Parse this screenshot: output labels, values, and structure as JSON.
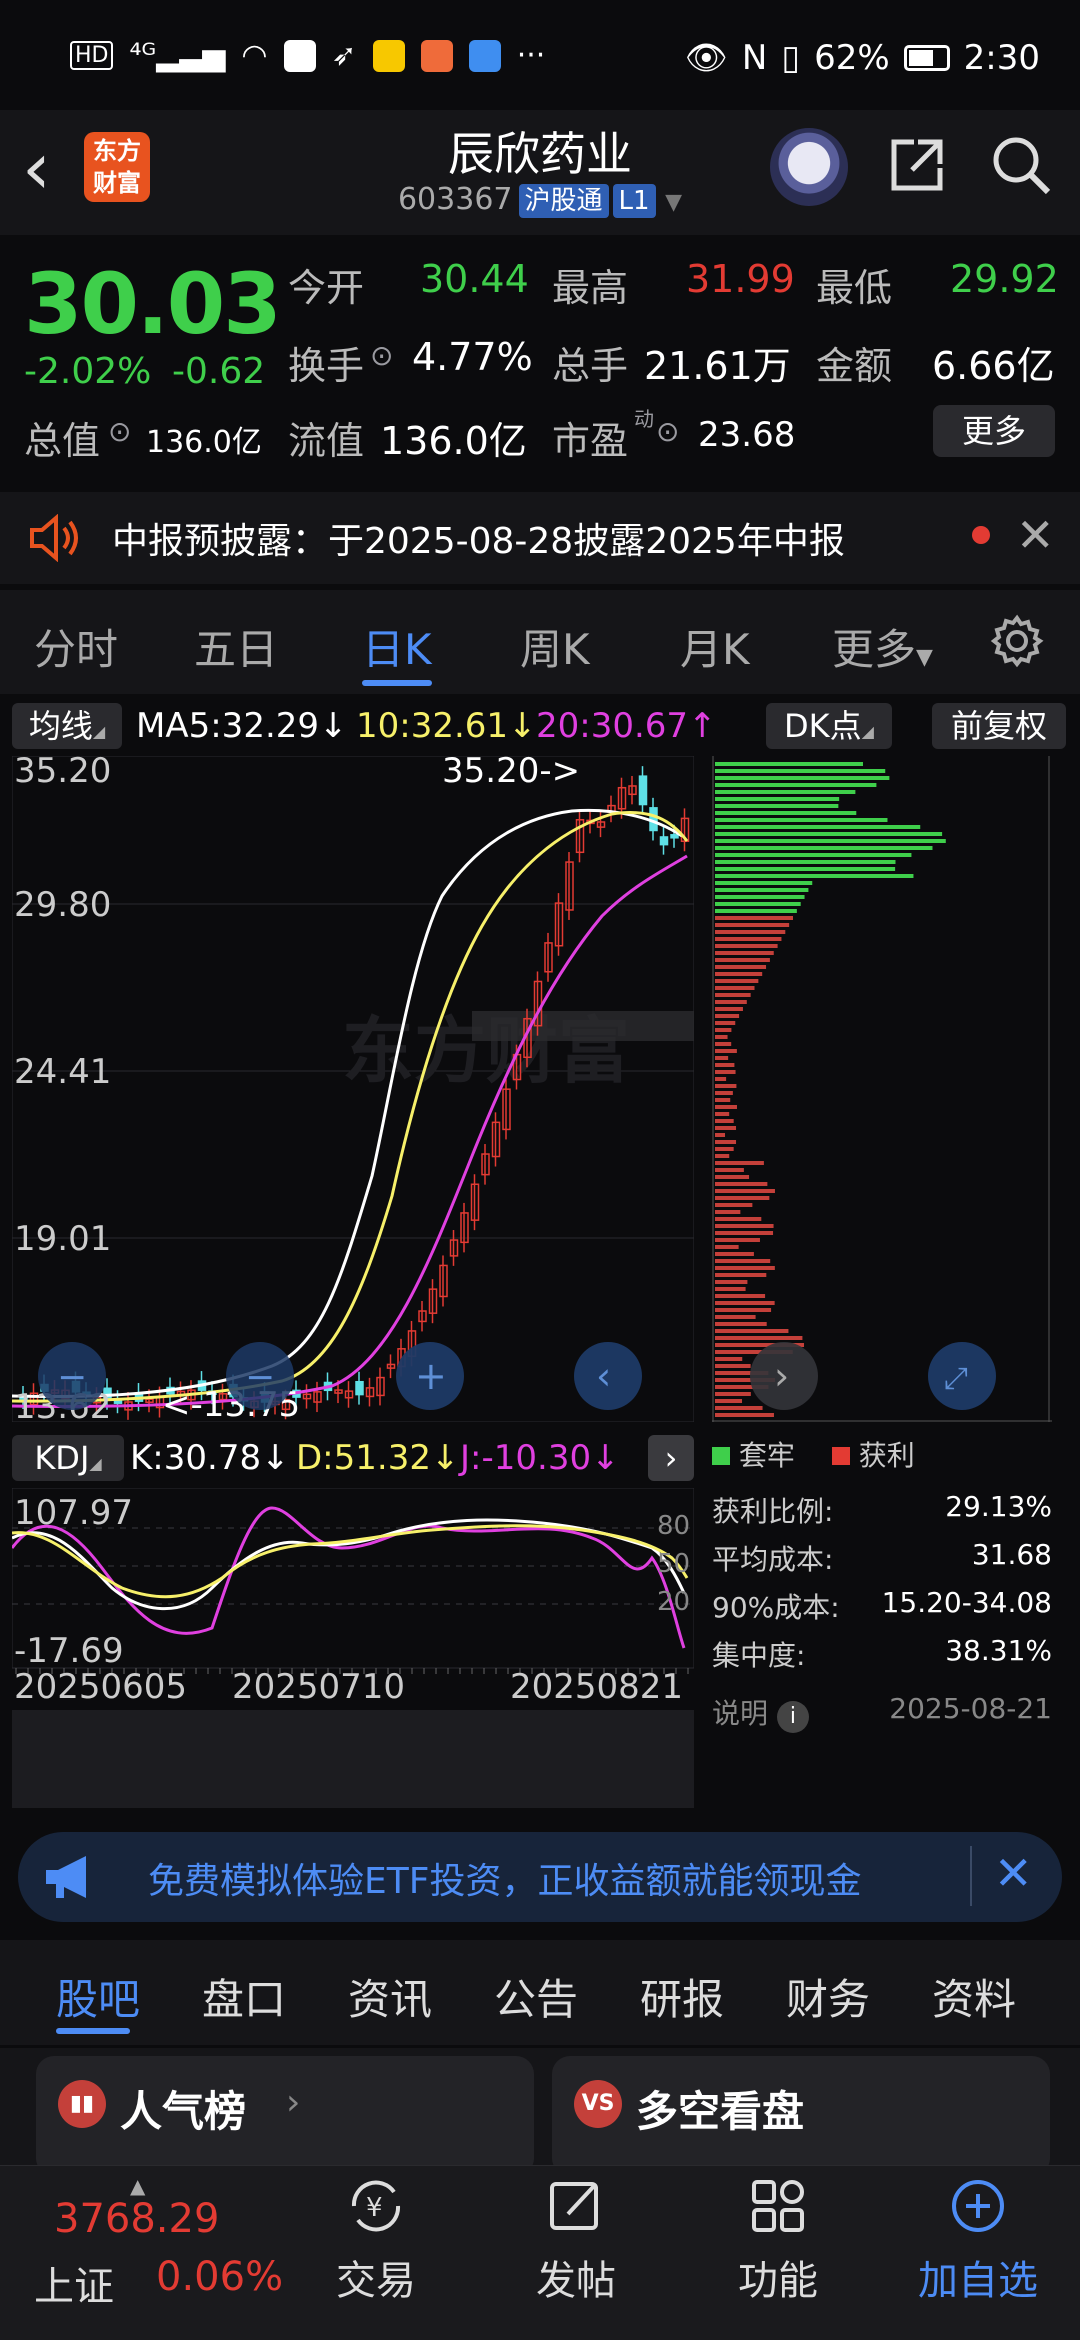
{
  "status_bar": {
    "left_items": [
      "HD",
      "4G",
      "signal",
      "wifi"
    ],
    "right_battery": "62%",
    "time": "2:30"
  },
  "header": {
    "app_logo_text": "东方财富",
    "stock_name": "辰欣药业",
    "stock_code": "603367",
    "tag_hgt": "沪股通",
    "tag_level": "L1"
  },
  "quote": {
    "price": "30.03",
    "pct": "-2.02%",
    "chg": "-0.62",
    "open_label": "今开",
    "open": "30.44",
    "high_label": "最高",
    "high": "31.99",
    "low_label": "最低",
    "low": "29.92",
    "turnover_label": "换手",
    "turnover": "4.77%",
    "volume_label": "总手",
    "volume": "21.61万",
    "amount_label": "金额",
    "amount": "6.66亿",
    "mktcap_label": "总值",
    "mktcap": "136.0亿",
    "float_label": "流值",
    "float": "136.0亿",
    "pe_label": "市盈",
    "pe_sup": "动",
    "pe": "23.68",
    "more_label": "更多"
  },
  "notice": {
    "text": "中报预披露：于2025-08-28披露2025年中报"
  },
  "chart_tabs": [
    "分时",
    "五日",
    "日K",
    "周K",
    "月K",
    "更多"
  ],
  "ma": {
    "label": "均线",
    "ma5": "MA5:32.29",
    "ma10": "10:32.61",
    "ma20": "20:30.67",
    "ma5_arrow": "↓",
    "ma10_arrow": "↓",
    "ma20_arrow": "↑",
    "dk": "DK点",
    "adjust": "前复权"
  },
  "main_chart": {
    "y_ticks": [
      "35.20",
      "29.80",
      "24.41",
      "19.01",
      "13.62"
    ],
    "max_annot": "35.20->",
    "min_annot": "<-13.75",
    "watermark": "东方财富"
  },
  "kdj": {
    "label": "KDJ",
    "k": "K:30.78↓",
    "d": "D:51.32↓",
    "j": "J:-10.30↓",
    "y_top": "107.97",
    "y_bottom": "-17.69",
    "right_ticks": [
      "80",
      "50",
      "20"
    ],
    "dates": [
      "20250605",
      "20250710",
      "20250821"
    ]
  },
  "chip": {
    "legend_trapped": "套牢",
    "legend_profit": "获利",
    "stats": [
      {
        "label": "获利比例:",
        "value": "29.13%"
      },
      {
        "label": "平均成本:",
        "value": "31.68"
      },
      {
        "label": "90%成本:",
        "value": "15.20-34.08"
      },
      {
        "label": "集中度:",
        "value": "38.31%"
      }
    ],
    "explain": "说明",
    "date": "2025-08-21"
  },
  "ad": {
    "text": "免费模拟体验ETF投资，正收益额就能领现金"
  },
  "info_tabs": [
    "股吧",
    "盘口",
    "资讯",
    "公告",
    "研报",
    "财务",
    "资料"
  ],
  "cards": [
    {
      "title": "人气榜",
      "icon": "rank"
    },
    {
      "title": "多空看盘",
      "icon": "VS"
    }
  ],
  "bottom_nav": {
    "index_value": "3768.29",
    "index_name": "上证",
    "index_pct": "0.06%",
    "items": [
      "交易",
      "发帖",
      "功能",
      "加自选"
    ]
  },
  "colors": {
    "up": "#e33b33",
    "down": "#3fcf4b",
    "accent": "#4d8cf5",
    "ma5": "#ffffff",
    "ma10": "#f7f06a",
    "ma20": "#e040e0"
  }
}
